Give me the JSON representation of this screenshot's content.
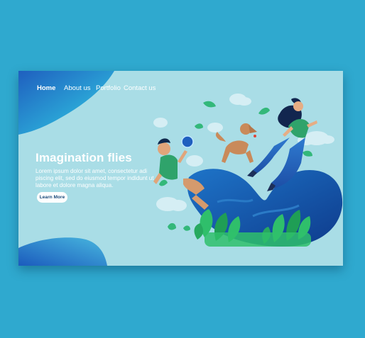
{
  "nav": {
    "items": [
      {
        "label": "Home",
        "active": true
      },
      {
        "label": "About us",
        "active": false
      },
      {
        "label": "Portfolio",
        "active": false
      },
      {
        "label": "Contact us",
        "active": false
      }
    ]
  },
  "hero": {
    "title": "Imagination flies",
    "text": "Lorem ipsum dolor sit amet, consectetur adi piscing elit, sed do eiusmod tempor indidunt ut labore et dolore magna aliqua.",
    "button_label": "Learn More"
  },
  "illustration": {
    "subjects": [
      "man-holding-ball",
      "jumping-dog",
      "floating-woman",
      "curved-hill",
      "green-plants",
      "clouds",
      "falling-leaves"
    ]
  },
  "colors": {
    "page_background": "#2fa9cf",
    "card_background": "#a9dde6",
    "accent_blue": "#1565c0",
    "plant_green": "#2fbf6b",
    "text_white": "#ffffff"
  }
}
